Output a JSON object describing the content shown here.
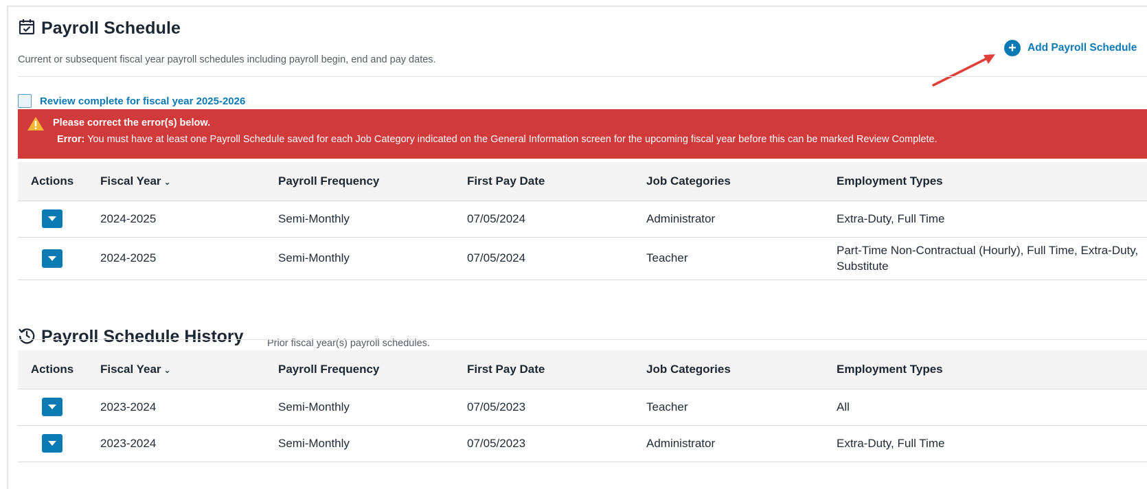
{
  "schedule": {
    "title": "Payroll Schedule",
    "subtitle": "Current or subsequent fiscal year payroll schedules including payroll begin, end and pay dates.",
    "add_button": "Add Payroll Schedule",
    "review_label": "Review complete for fiscal year 2025-2026",
    "alert": {
      "heading": "Please correct the error(s) below.",
      "error_prefix": "Error:",
      "error_message": "You must have at least one Payroll Schedule saved for each Job Category indicated on the General Information screen for the upcoming fiscal year before this can be marked Review Complete."
    },
    "columns": {
      "actions": "Actions",
      "fiscal_year": "Fiscal Year",
      "payroll_frequency": "Payroll Frequency",
      "first_pay_date": "First Pay Date",
      "job_categories": "Job Categories",
      "employment_types": "Employment Types"
    },
    "rows": [
      {
        "fiscal_year": "2024-2025",
        "payroll_frequency": "Semi-Monthly",
        "first_pay_date": "07/05/2024",
        "job_category": "Administrator",
        "employment_types": "Extra-Duty, Full Time"
      },
      {
        "fiscal_year": "2024-2025",
        "payroll_frequency": "Semi-Monthly",
        "first_pay_date": "07/05/2024",
        "job_category": "Teacher",
        "employment_types": "Part-Time Non-Contractual (Hourly), Full Time, Extra-Duty, Substitute"
      }
    ]
  },
  "history": {
    "title": "Payroll Schedule History",
    "subtitle": "Prior fiscal year(s) payroll schedules.",
    "columns": {
      "actions": "Actions",
      "fiscal_year": "Fiscal Year",
      "payroll_frequency": "Payroll Frequency",
      "first_pay_date": "First Pay Date",
      "job_categories": "Job Categories",
      "employment_types": "Employment Types"
    },
    "rows": [
      {
        "fiscal_year": "2023-2024",
        "payroll_frequency": "Semi-Monthly",
        "first_pay_date": "07/05/2023",
        "job_category": "Teacher",
        "employment_types": "All"
      },
      {
        "fiscal_year": "2023-2024",
        "payroll_frequency": "Semi-Monthly",
        "first_pay_date": "07/05/2023",
        "job_category": "Administrator",
        "employment_types": "Extra-Duty, Full Time"
      }
    ]
  },
  "colors": {
    "accent": "#0a7ab4",
    "error_bg": "#d13a3a",
    "annotation_arrow": "#e0403a"
  },
  "icons": {
    "schedule_title": "calendar-check-icon",
    "history_title": "history-clock-icon",
    "add": "plus-circle-icon",
    "alert": "warning-triangle-icon",
    "row_action": "caret-down-icon",
    "sort": "chevron-down-icon"
  }
}
